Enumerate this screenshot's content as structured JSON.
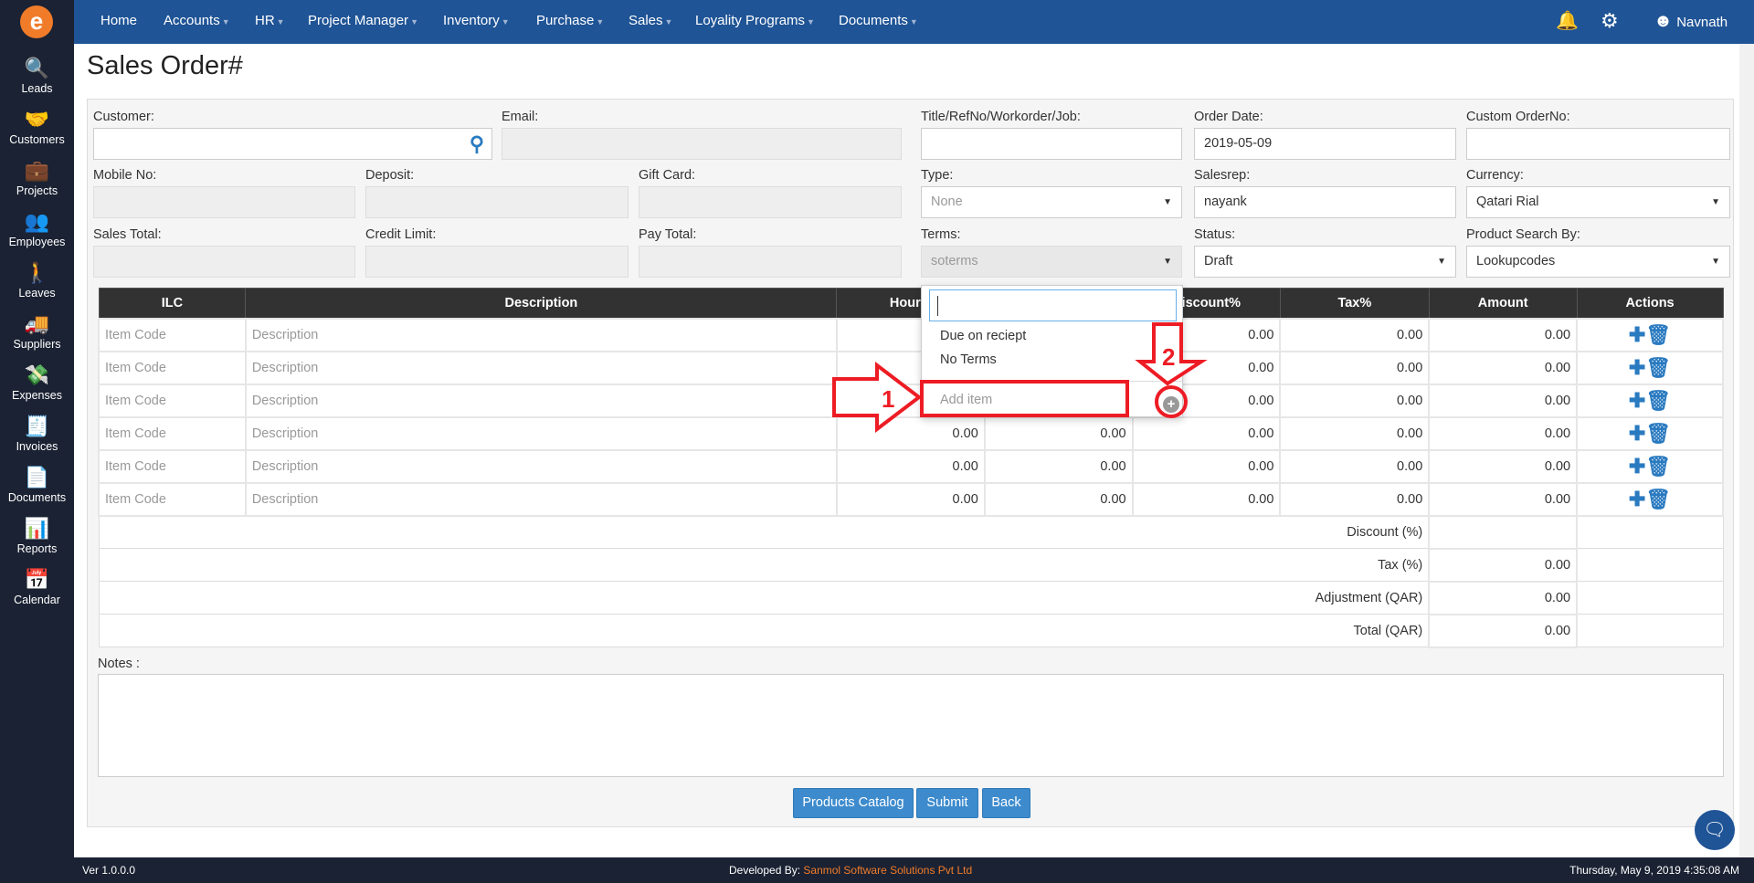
{
  "nav": {
    "items": [
      {
        "label": "Home",
        "caret": false
      },
      {
        "label": "Accounts",
        "caret": true
      },
      {
        "label": "HR",
        "caret": true
      },
      {
        "label": "Project Manager",
        "caret": true
      },
      {
        "label": "Inventory",
        "caret": true
      },
      {
        "label": "Purchase",
        "caret": true
      },
      {
        "label": "Sales",
        "caret": true
      },
      {
        "label": "Loyality Programs",
        "caret": true
      },
      {
        "label": "Documents",
        "caret": true
      }
    ],
    "user": "Navnath"
  },
  "sidebar": {
    "items": [
      {
        "label": "Leads",
        "icon": "leads-icon"
      },
      {
        "label": "Customers",
        "icon": "customers-icon"
      },
      {
        "label": "Projects",
        "icon": "projects-icon"
      },
      {
        "label": "Employees",
        "icon": "employees-icon"
      },
      {
        "label": "Leaves",
        "icon": "leaves-icon"
      },
      {
        "label": "Suppliers",
        "icon": "suppliers-icon"
      },
      {
        "label": "Expenses",
        "icon": "expenses-icon"
      },
      {
        "label": "Invoices",
        "icon": "invoices-icon"
      },
      {
        "label": "Documents",
        "icon": "documents-icon"
      },
      {
        "label": "Reports",
        "icon": "reports-icon"
      },
      {
        "label": "Calendar",
        "icon": "calendar-icon"
      }
    ]
  },
  "page": {
    "title": "Sales Order#"
  },
  "form": {
    "customer": {
      "label": "Customer:",
      "value": ""
    },
    "email": {
      "label": "Email:",
      "value": ""
    },
    "title": {
      "label": "Title/RefNo/Workorder/Job:",
      "value": ""
    },
    "order_date": {
      "label": "Order Date:",
      "value": "2019-05-09"
    },
    "custom_order": {
      "label": "Custom OrderNo:",
      "value": ""
    },
    "mobile": {
      "label": "Mobile No:",
      "value": ""
    },
    "deposit": {
      "label": "Deposit:",
      "value": ""
    },
    "gift_card": {
      "label": "Gift Card:",
      "value": ""
    },
    "type": {
      "label": "Type:",
      "value": "None"
    },
    "salesrep": {
      "label": "Salesrep:",
      "value": "nayank"
    },
    "currency": {
      "label": "Currency:",
      "value": "Qatari Rial"
    },
    "sales_total": {
      "label": "Sales Total:",
      "value": ""
    },
    "credit_limit": {
      "label": "Credit Limit:",
      "value": ""
    },
    "pay_total": {
      "label": "Pay Total:",
      "value": ""
    },
    "terms": {
      "label": "Terms:",
      "value": "soterms"
    },
    "status": {
      "label": "Status:",
      "value": "Draft"
    },
    "product_search": {
      "label": "Product Search By:",
      "value": "Lookupcodes"
    }
  },
  "table": {
    "headers": [
      "ILC",
      "Description",
      "Hours/",
      "",
      "Discount%",
      "Tax%",
      "Amount",
      "Actions"
    ],
    "placeholder_code": "Item Code",
    "placeholder_desc": "Description",
    "rows": [
      {
        "hours": "",
        "rate": "",
        "discount": "0.00",
        "tax": "0.00",
        "amount": "0.00"
      },
      {
        "hours": "",
        "rate": "",
        "discount": "0.00",
        "tax": "0.00",
        "amount": "0.00"
      },
      {
        "hours": "",
        "rate": "",
        "discount": "0.00",
        "tax": "0.00",
        "amount": "0.00"
      },
      {
        "hours": "0.00",
        "rate": "0.00",
        "discount": "0.00",
        "tax": "0.00",
        "amount": "0.00"
      },
      {
        "hours": "0.00",
        "rate": "0.00",
        "discount": "0.00",
        "tax": "0.00",
        "amount": "0.00"
      },
      {
        "hours": "0.00",
        "rate": "0.00",
        "discount": "0.00",
        "tax": "0.00",
        "amount": "0.00"
      }
    ]
  },
  "summary": [
    {
      "label": "Discount (%)",
      "value": ""
    },
    {
      "label": "Tax (%)",
      "value": "0.00"
    },
    {
      "label": "Adjustment (QAR)",
      "value": "0.00"
    },
    {
      "label": "Total (QAR)",
      "value": "0.00"
    }
  ],
  "notes": {
    "label": "Notes :",
    "value": ""
  },
  "buttons": {
    "catalog": "Products Catalog",
    "submit": "Submit",
    "back": "Back"
  },
  "dropdown": {
    "search": "",
    "options": [
      "Due on reciept",
      "No Terms"
    ],
    "add_placeholder": "Add item"
  },
  "annotations": {
    "one": "1",
    "two": "2",
    "color": "#ed1c24"
  },
  "footer": {
    "version": "Ver 1.0.0.0",
    "dev_prefix": "Developed By:",
    "dev_company": "Sanmol Software Solutions Pvt Ltd",
    "datetime": "Thursday, May 9, 2019 4:35:08 AM"
  },
  "colors": {
    "nav": "#1f5496",
    "sidebar": "#1b2233",
    "button": "#3d8bcd",
    "accent_link": "#f07c2a"
  }
}
